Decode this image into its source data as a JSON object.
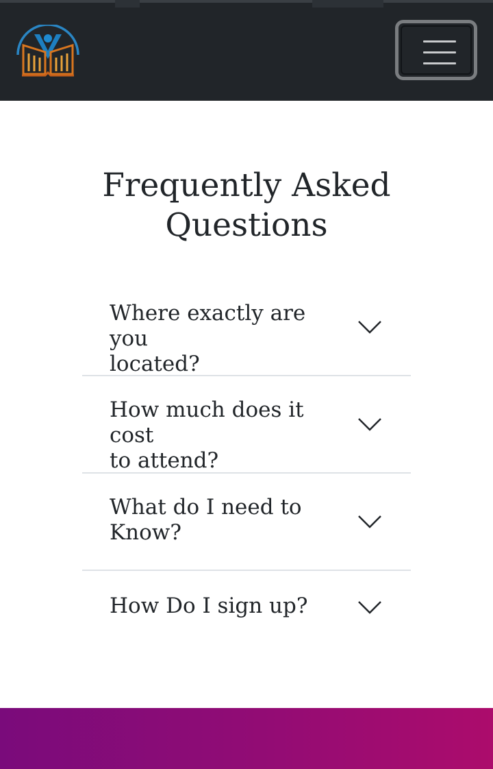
{
  "header": {
    "logo_icon": "book-person-logo-icon",
    "menu_icon": "hamburger-menu-icon",
    "background_color": "#212529"
  },
  "faq": {
    "title": "Frequently Asked Questions",
    "items": [
      {
        "question_line1": "Where exactly are you",
        "question_line2": "located?",
        "icon": "chevron-down-icon"
      },
      {
        "question_line1": "How much does it cost",
        "question_line2": "to attend?",
        "icon": "chevron-down-icon"
      },
      {
        "question_line1": "What do I need to",
        "question_line2": "Know?",
        "icon": "chevron-down-icon"
      },
      {
        "question_line1": "How Do I sign up?",
        "question_line2": "",
        "icon": "chevron-down-icon"
      }
    ]
  },
  "footer": {
    "gradient_start": "#7a0b7b",
    "gradient_end": "#ac0c6c"
  }
}
